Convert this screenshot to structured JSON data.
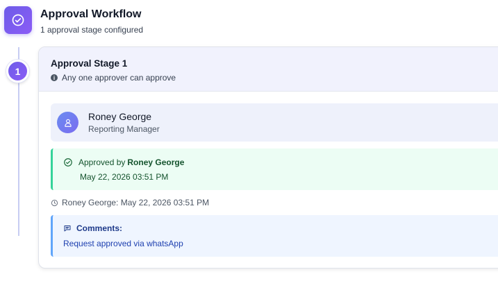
{
  "header": {
    "title": "Approval Workflow",
    "subtitle": "1 approval stage configured",
    "icon": "check-circle-icon"
  },
  "stage": {
    "number": "1",
    "title": "Approval Stage 1",
    "rule": "Any one approver can approve",
    "approver": {
      "name": "Roney George",
      "role": "Reporting Manager"
    },
    "approval": {
      "prefix": "Approved by",
      "by": "Roney George",
      "date": "May 22, 2026 03:51 PM"
    },
    "timestamp": "Roney George: May 22, 2026 03:51 PM",
    "comments": {
      "label": "Comments:",
      "text": "Request approved via whatsApp"
    }
  },
  "colors": {
    "accent": "#6d5ce8",
    "success": "#34d399",
    "info": "#60a5fa"
  }
}
